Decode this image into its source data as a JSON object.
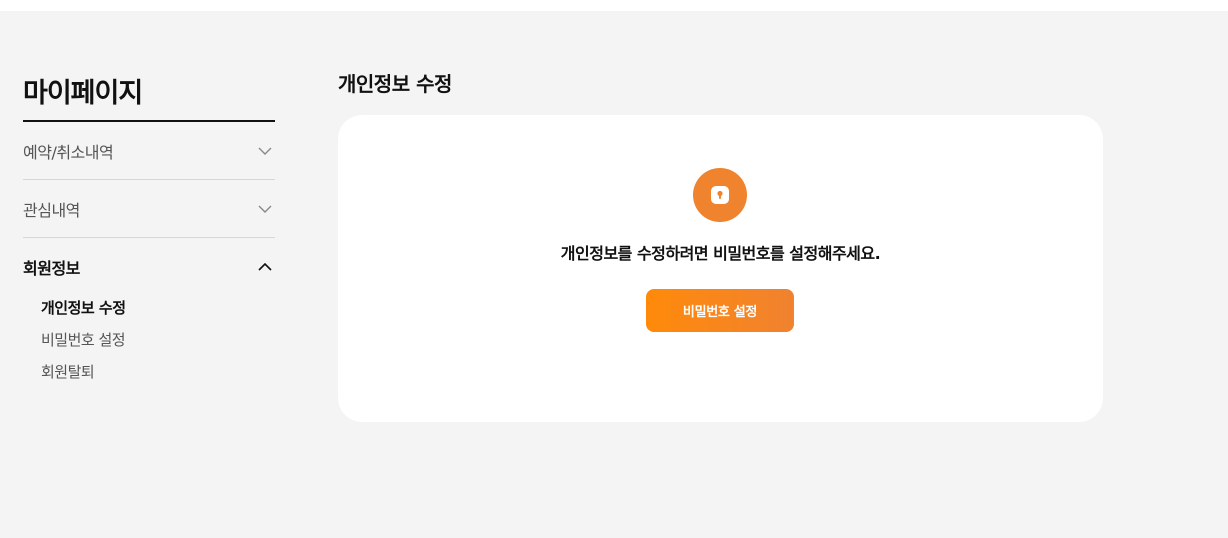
{
  "sidebar": {
    "title": "마이페이지",
    "sections": [
      {
        "label": "예약/취소내역",
        "icon": "chevron-down-icon"
      },
      {
        "label": "관심내역",
        "icon": "chevron-down-icon"
      },
      {
        "label": "회원정보",
        "icon": "chevron-up-icon"
      }
    ],
    "sub_items": [
      {
        "label": "개인정보 수정",
        "active": true
      },
      {
        "label": "비밀번호 설정",
        "active": false
      },
      {
        "label": "회원탈퇴",
        "active": false
      }
    ]
  },
  "main": {
    "title": "개인정보 수정",
    "lock_icon": "lock-icon",
    "message": "개인정보를 수정하려면 비밀번호를 설정해주세요.",
    "button_label": "비밀번호 설정"
  },
  "colors": {
    "accent": "#f0832d",
    "button_gradient_start": "#ff8a0a",
    "background": "#f4f4f4"
  }
}
